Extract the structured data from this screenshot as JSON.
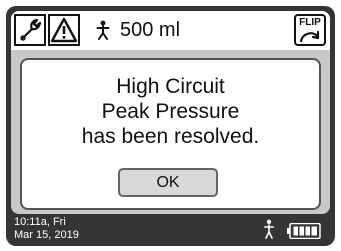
{
  "header": {
    "icons": [
      "wrench-icon",
      "warning-triangle-icon",
      "person-icon",
      "flip-icon"
    ],
    "volume": "500 ml",
    "flip_label": "FLIP"
  },
  "dialog": {
    "message_lines": [
      "High Circuit",
      "Peak Pressure",
      "has been resolved."
    ],
    "ok_label": "OK"
  },
  "status_bar": {
    "time": "10:11a, Fri",
    "date": "Mar 15, 2019",
    "icons": [
      "person-icon",
      "battery-icon"
    ],
    "battery_level": 1.0
  },
  "colors": {
    "screen_frame": "#333536",
    "panel_background": "#c9c9c9",
    "dialog_background": "#ffffff",
    "button_background": "#d9d9d9"
  }
}
